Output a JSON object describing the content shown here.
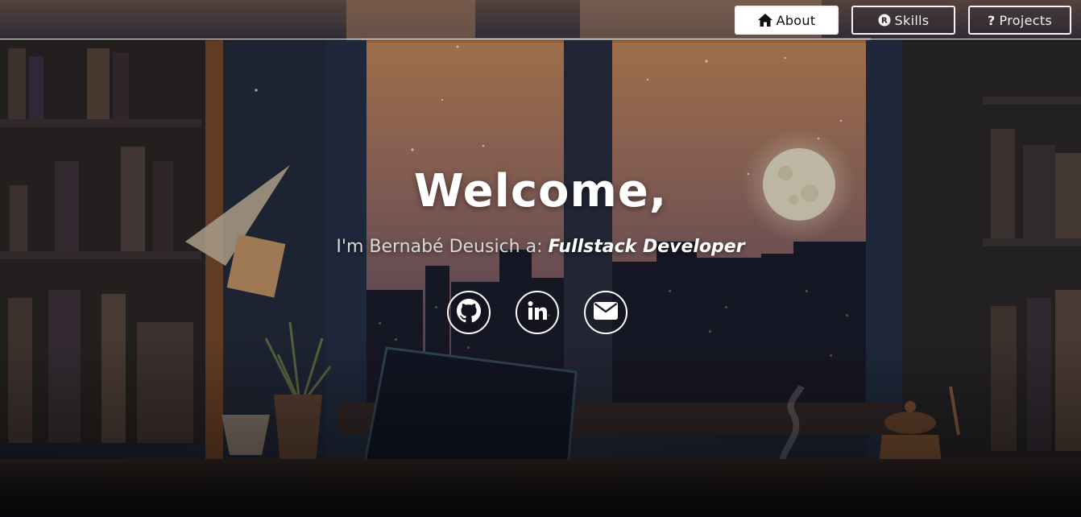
{
  "nav": {
    "items": [
      {
        "label": "About",
        "icon": "home-icon",
        "active": true
      },
      {
        "label": "Skills",
        "icon": "registered-icon",
        "active": false
      },
      {
        "label": "Projects",
        "icon": "question-icon",
        "active": false
      }
    ]
  },
  "hero": {
    "title": "Welcome,",
    "subtitle_prefix": "I'm Bernabé Deusich a: ",
    "subtitle_role": "Fullstack Developer"
  },
  "socials": [
    {
      "icon": "github-icon"
    },
    {
      "icon": "linkedin-icon"
    },
    {
      "icon": "mail-icon"
    }
  ],
  "colors": {
    "sky_top": "#c98a58",
    "sky_bottom": "#5a4a66",
    "room_dark": "#1c2233",
    "moon": "#efe6c9"
  }
}
